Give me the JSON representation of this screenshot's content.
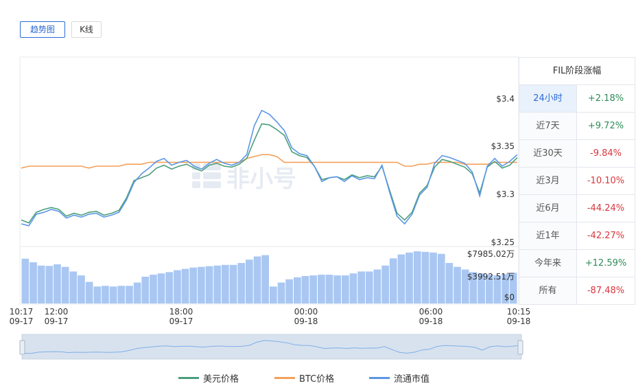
{
  "tabs": [
    {
      "label": "趋势图",
      "active": true
    },
    {
      "label": "K线",
      "active": false
    }
  ],
  "chart_data": {
    "type": "line",
    "series": [
      {
        "name": "美元价格",
        "color": "#4a9e7c",
        "values": [
          3.274,
          3.271,
          3.282,
          3.285,
          3.287,
          3.285,
          3.278,
          3.281,
          3.279,
          3.282,
          3.283,
          3.279,
          3.281,
          3.284,
          3.297,
          3.315,
          3.318,
          3.321,
          3.328,
          3.331,
          3.327,
          3.33,
          3.332,
          3.328,
          3.325,
          3.331,
          3.333,
          3.33,
          3.329,
          3.332,
          3.338,
          3.357,
          3.374,
          3.373,
          3.368,
          3.362,
          3.345,
          3.341,
          3.339,
          3.33,
          3.316,
          3.318,
          3.319,
          3.316,
          3.321,
          3.318,
          3.32,
          3.319,
          3.33,
          3.305,
          3.281,
          3.274,
          3.282,
          3.302,
          3.31,
          3.329,
          3.337,
          3.335,
          3.332,
          3.329,
          3.322,
          3.302,
          3.329,
          3.335,
          3.328,
          3.331,
          3.339
        ]
      },
      {
        "name": "BTC价格",
        "color": "#f5a05a",
        "values": [
          3.328,
          3.33,
          3.33,
          3.33,
          3.33,
          3.33,
          3.33,
          3.33,
          3.33,
          3.328,
          3.33,
          3.33,
          3.33,
          3.33,
          3.332,
          3.332,
          3.332,
          3.334,
          3.334,
          3.334,
          3.334,
          3.334,
          3.334,
          3.334,
          3.334,
          3.334,
          3.334,
          3.334,
          3.334,
          3.334,
          3.338,
          3.34,
          3.342,
          3.342,
          3.34,
          3.334,
          3.334,
          3.334,
          3.334,
          3.334,
          3.334,
          3.334,
          3.334,
          3.334,
          3.334,
          3.334,
          3.334,
          3.334,
          3.334,
          3.334,
          3.334,
          3.33,
          3.33,
          3.332,
          3.332,
          3.334,
          3.334,
          3.334,
          3.334,
          3.332,
          3.332,
          3.332,
          3.332,
          3.334,
          3.334,
          3.334,
          3.334
        ]
      },
      {
        "name": "流通市值",
        "color": "#5b96e6",
        "values": [
          3.27,
          3.268,
          3.28,
          3.282,
          3.285,
          3.283,
          3.276,
          3.279,
          3.277,
          3.28,
          3.281,
          3.277,
          3.279,
          3.282,
          3.295,
          3.313,
          3.322,
          3.328,
          3.335,
          3.338,
          3.331,
          3.334,
          3.336,
          3.33,
          3.327,
          3.333,
          3.337,
          3.333,
          3.331,
          3.334,
          3.342,
          3.372,
          3.388,
          3.384,
          3.376,
          3.367,
          3.349,
          3.343,
          3.341,
          3.33,
          3.314,
          3.318,
          3.319,
          3.314,
          3.32,
          3.316,
          3.318,
          3.317,
          3.331,
          3.303,
          3.278,
          3.27,
          3.28,
          3.3,
          3.308,
          3.333,
          3.341,
          3.339,
          3.336,
          3.333,
          3.324,
          3.299,
          3.33,
          3.338,
          3.33,
          3.335,
          3.342
        ]
      }
    ],
    "ylim": [
      3.25,
      3.42
    ],
    "y_ticks": [
      "$3.4",
      "$3.35",
      "$3.3",
      "$3.25"
    ],
    "y_tick_values": [
      3.4,
      3.35,
      3.3,
      3.25
    ],
    "volume": {
      "name": "流通市值",
      "color": "#a9c7f2",
      "max": 7985.02,
      "ticks": [
        "$7985.02万",
        "$3992.51万",
        "$0"
      ],
      "values": [
        6850,
        6300,
        5800,
        5750,
        6000,
        5600,
        4900,
        4300,
        3300,
        2600,
        2700,
        2600,
        2700,
        2700,
        3200,
        4100,
        4400,
        4600,
        4800,
        5100,
        5300,
        5500,
        5600,
        5700,
        5800,
        5900,
        5900,
        6200,
        6700,
        7200,
        7400,
        2600,
        3200,
        3700,
        4000,
        4200,
        4300,
        4400,
        4400,
        4300,
        4300,
        4600,
        4900,
        4900,
        5200,
        5800,
        6900,
        7500,
        7800,
        7985,
        7900,
        7800,
        7600,
        6200,
        5600,
        5200,
        4800,
        4600,
        4400,
        4300,
        4500,
        4700
      ]
    },
    "x_ticks": [
      {
        "time": "10:17",
        "date": "09-17"
      },
      {
        "time": "12:00",
        "date": "09-17"
      },
      {
        "time": "18:00",
        "date": "09-17"
      },
      {
        "time": "00:00",
        "date": "09-18"
      },
      {
        "time": "06:00",
        "date": "09-18"
      },
      {
        "time": "10:15",
        "date": "09-18"
      }
    ]
  },
  "stage_table": {
    "title": "FIL阶段涨幅",
    "rows": [
      {
        "label": "24小时",
        "value": "+2.18%",
        "color": "#2e8b57",
        "selected": true
      },
      {
        "label": "近7天",
        "value": "+9.72%",
        "color": "#2e8b57",
        "selected": false
      },
      {
        "label": "近30天",
        "value": "-9.84%",
        "color": "#d9363e",
        "selected": false
      },
      {
        "label": "近3月",
        "value": "-10.10%",
        "color": "#d9363e",
        "selected": false
      },
      {
        "label": "近6月",
        "value": "-44.24%",
        "color": "#d9363e",
        "selected": false
      },
      {
        "label": "近1年",
        "value": "-42.27%",
        "color": "#d9363e",
        "selected": false
      },
      {
        "label": "今年来",
        "value": "+12.59%",
        "color": "#2e8b57",
        "selected": false
      },
      {
        "label": "所有",
        "value": "-87.48%",
        "color": "#d9363e",
        "selected": false
      }
    ]
  },
  "legend": [
    {
      "label": "美元价格",
      "color": "#4a9e7c"
    },
    {
      "label": "BTC价格",
      "color": "#f5a05a"
    },
    {
      "label": "流通市值",
      "color": "#5b96e6"
    }
  ],
  "watermark": "非小号"
}
